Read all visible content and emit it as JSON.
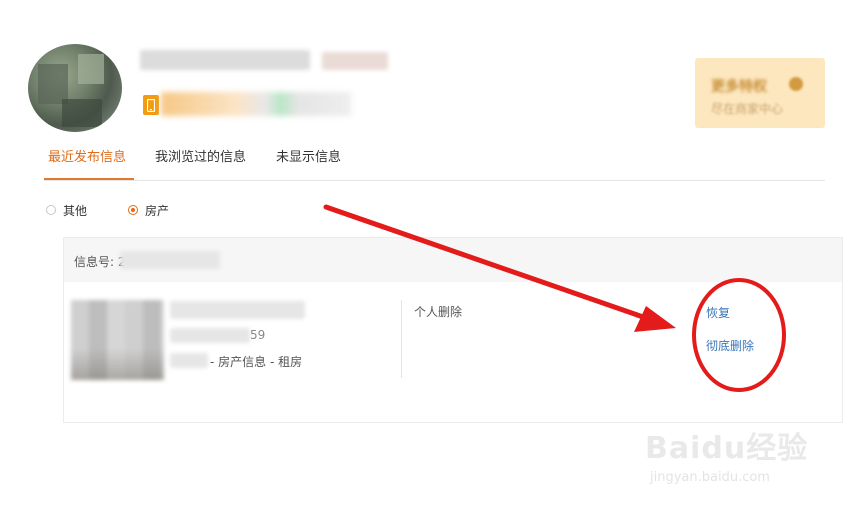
{
  "header": {
    "promo_title": "更多特权",
    "promo_subtitle": "尽在商家中心"
  },
  "tabs": [
    {
      "label": "最近发布信息",
      "active": true
    },
    {
      "label": "我浏览过的信息",
      "active": false
    },
    {
      "label": "未显示信息",
      "active": false
    }
  ],
  "filters": [
    {
      "label": "其他",
      "selected": false
    },
    {
      "label": "房产",
      "selected": true
    }
  ],
  "item": {
    "info_label": "信息号: 24",
    "date_suffix": "59",
    "category_path": "- 房产信息 - 租房",
    "status": "个人删除",
    "actions": {
      "restore": "恢复",
      "delete_permanently": "彻底删除"
    }
  },
  "watermark": {
    "brand": "Baidu经验",
    "url": "jingyan.baidu.com"
  },
  "colors": {
    "accent": "#e06b1a",
    "link": "#3a76b8",
    "annotation": "#e31b1b",
    "promo_bg": "#fde7bf"
  }
}
